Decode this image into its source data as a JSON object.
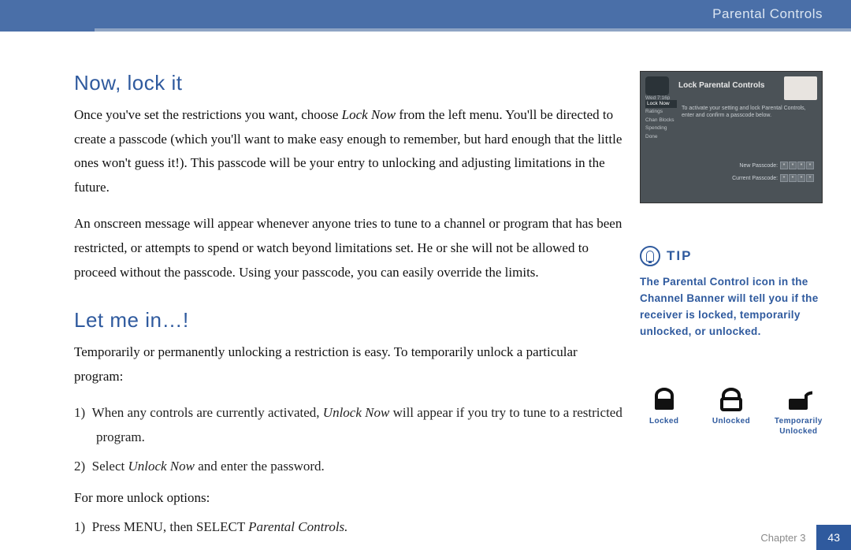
{
  "header": {
    "breadcrumb": "Parental Controls"
  },
  "section1": {
    "title": "Now, lock it",
    "p1_a": "Once you've set the restrictions you want, choose ",
    "p1_em": "Lock Now",
    "p1_b": " from the left menu. You'll be directed to create a passcode (which you'll want to make easy enough to remember, but hard enough that the little ones won't guess it!). This passcode will be your entry to unlocking and adjusting limitations in the future.",
    "p2": "An onscreen message will appear whenever anyone tries to tune to a channel or program that has been restricted, or attempts to spend or watch beyond limitations set. He or she will not be allowed to proceed without the passcode. Using your passcode, you can easily override the limits."
  },
  "section2": {
    "title": "Let me in…!",
    "intro": "Temporarily or permanently unlocking a restriction is easy. To temporarily unlock a particular program:",
    "li1_a": "When any controls are currently activated, ",
    "li1_em": "Unlock Now",
    "li1_b": " will appear if you try to tune to a restricted program.",
    "li2_a": "Select ",
    "li2_em": "Unlock Now",
    "li2_b": " and enter the password.",
    "more": "For more unlock options:",
    "li3_a": "Press MENU, then SELECT ",
    "li3_em": "Parental Controls.",
    "num1": "1)",
    "num2": "2)",
    "num3": "1)"
  },
  "screenshot": {
    "title": "Lock Parental Controls",
    "date": "Wed 7:16p",
    "menu": [
      "Lock Now",
      "Ratings",
      "Chan Blocks",
      "Spending",
      "Done"
    ],
    "body": "To activate your setting and lock Parental Controls, enter and confirm a passcode below.",
    "field1": "New Passcode:",
    "field2": "Current Passcode:"
  },
  "tip": {
    "label": "TIP",
    "text": "The Parental Control icon in the Channel Banner will tell you if the receiver is locked, temporarily unlocked, or unlocked."
  },
  "lock_icons": {
    "locked": "Locked",
    "unlocked": "Unlocked",
    "temp": "Temporarily Unlocked"
  },
  "footer": {
    "chapter": "Chapter 3",
    "page": "43"
  }
}
